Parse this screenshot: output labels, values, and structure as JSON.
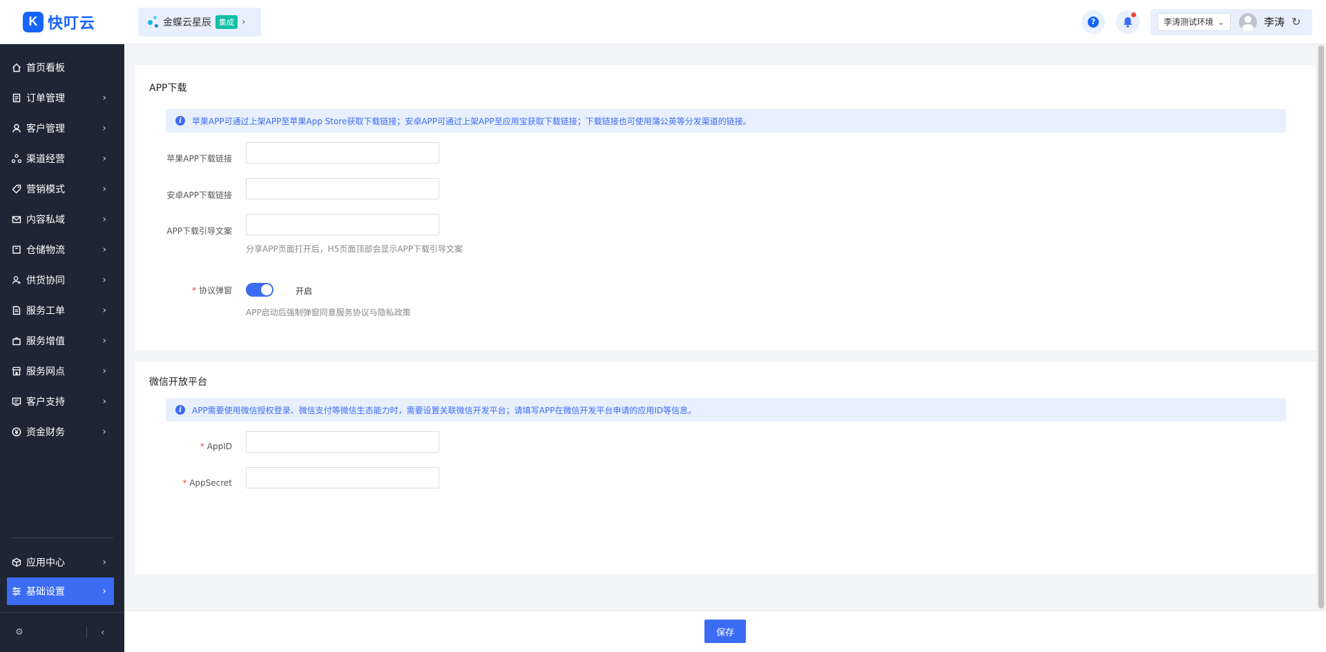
{
  "app": {
    "logo_mark": "K",
    "name": "快叮云"
  },
  "product": {
    "name": "金蝶云星辰",
    "badge": "集成",
    "chevron": "›"
  },
  "header": {
    "help": "?",
    "env_label": "李涛测试环境",
    "env_chevron": "⌄",
    "user_name": "李涛",
    "refresh": "↻"
  },
  "sidebar": {
    "items": [
      {
        "label": "首页看板",
        "icon": "home-icon",
        "chevron": ""
      },
      {
        "label": "订单管理",
        "icon": "clipboard-icon",
        "chevron": "›"
      },
      {
        "label": "客户管理",
        "icon": "user-icon",
        "chevron": "›"
      },
      {
        "label": "渠道经营",
        "icon": "channel-icon",
        "chevron": "›"
      },
      {
        "label": "营销模式",
        "icon": "tag-icon",
        "chevron": "›"
      },
      {
        "label": "内容私域",
        "icon": "mail-icon",
        "chevron": "›"
      },
      {
        "label": "仓储物流",
        "icon": "box-icon",
        "chevron": "›"
      },
      {
        "label": "供货协同",
        "icon": "people-icon",
        "chevron": "›"
      },
      {
        "label": "服务工单",
        "icon": "doc-icon",
        "chevron": "›"
      },
      {
        "label": "服务增值",
        "icon": "bag-icon",
        "chevron": "›"
      },
      {
        "label": "服务网点",
        "icon": "store-icon",
        "chevron": "›"
      },
      {
        "label": "客户支持",
        "icon": "support-icon",
        "chevron": "›"
      },
      {
        "label": "资金财务",
        "icon": "yen-icon",
        "chevron": "›"
      }
    ],
    "bottom_items": [
      {
        "label": "应用中心",
        "icon": "cube-icon",
        "chevron": "›"
      },
      {
        "label": "基础设置",
        "icon": "settings-list-icon",
        "chevron": "›"
      }
    ],
    "footer": {
      "settings": "⚙",
      "collapse": "‹"
    }
  },
  "app_download": {
    "title": "APP下载",
    "info": "苹果APP可通过上架APP至苹果App Store获取下载链接；安卓APP可通过上架APP至应用宝获取下载链接；下载链接也可使用蒲公英等分发渠道的链接。",
    "fields": [
      {
        "label": "苹果APP下载链接",
        "value": ""
      },
      {
        "label": "安卓APP下载链接",
        "value": ""
      },
      {
        "label": "APP下载引导文案",
        "value": ""
      }
    ],
    "guide_hint": "分享APP页面打开后，H5页面顶部会显示APP下载引导文案",
    "agreement": {
      "required_mark": "*",
      "label": "协议弹窗",
      "state": "开启",
      "hint": "APP启动后强制弹窗同意服务协议与隐私政策"
    }
  },
  "wechat": {
    "title": "微信开放平台",
    "info": "APP需要使用微信授权登录、微信支付等微信生态能力时，需要设置关联微信开发平台；请填写APP在微信开发平台申请的应用ID等信息。",
    "fields": [
      {
        "required_mark": "*",
        "label": "AppID",
        "value": ""
      },
      {
        "required_mark": "*",
        "label": "AppSecret",
        "value": ""
      }
    ]
  },
  "footer": {
    "save_label": "保存"
  },
  "colors": {
    "primary": "#3c6cf4",
    "brand": "#1664ff",
    "sidebar": "#1e2636",
    "danger": "#f53f3f",
    "badge": "#12bfa5"
  }
}
